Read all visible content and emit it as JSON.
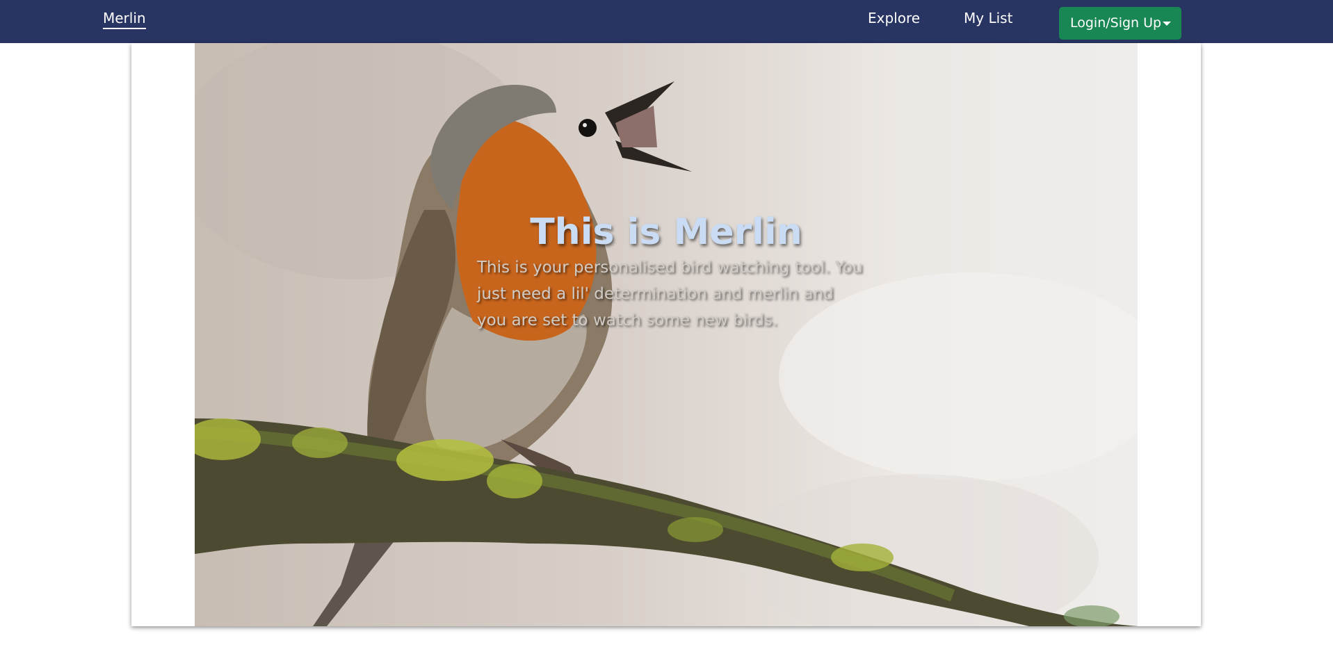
{
  "navbar": {
    "brand": "Merlin",
    "links": [
      "Explore",
      "My List"
    ],
    "login_button": "Login/Sign Up",
    "background": "#283462",
    "button_color": "#198754"
  },
  "hero": {
    "title": "This is Merlin",
    "description": "This is your personalised bird watching tool. You just need a lil' determination and merlin and you are set to watch some new birds.",
    "image_alt": "robin singing on a mossy branch"
  },
  "icons": [
    "caret-down-icon"
  ]
}
